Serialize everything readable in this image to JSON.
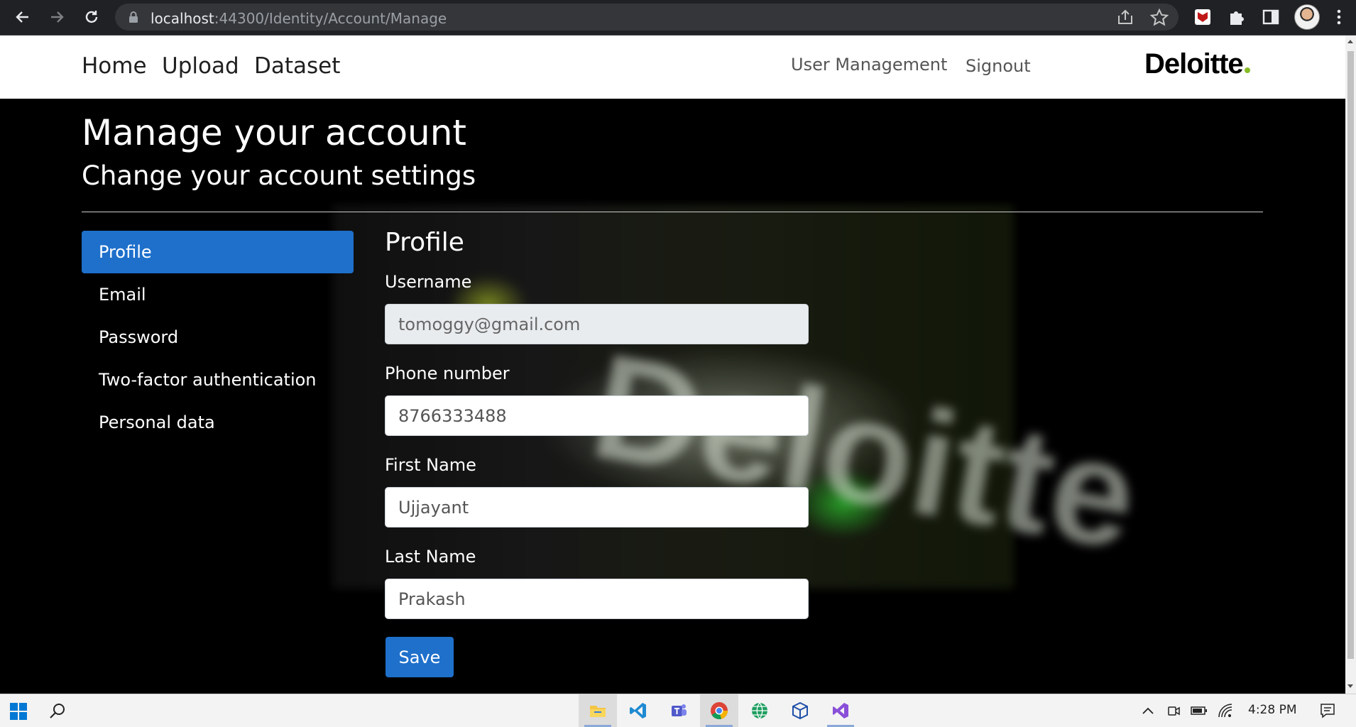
{
  "browser": {
    "url_host": "localhost",
    "url_path": ":44300/Identity/Account/Manage"
  },
  "header": {
    "nav": [
      "Home",
      "Upload",
      "Dataset"
    ],
    "user_management": "User Management",
    "signout": "Signout",
    "logo_text": "Deloitte",
    "logo_dot_color": "#86bc25"
  },
  "page": {
    "title": "Manage your account",
    "subtitle": "Change your account settings"
  },
  "sidebar": {
    "items": [
      {
        "label": "Profile",
        "active": true
      },
      {
        "label": "Email"
      },
      {
        "label": "Password"
      },
      {
        "label": "Two-factor authentication"
      },
      {
        "label": "Personal data"
      }
    ]
  },
  "form": {
    "title": "Profile",
    "username_label": "Username",
    "username_value": "tomoggy@gmail.com",
    "phone_label": "Phone number",
    "phone_value": "8766333488",
    "first_name_label": "First Name",
    "first_name_value": "Ujjayant",
    "last_name_label": "Last Name",
    "last_name_value": "Prakash",
    "save_label": "Save"
  },
  "taskbar": {
    "clock": "4:28 PM",
    "apps": [
      "file-explorer-icon",
      "vscode-icon",
      "teams-icon",
      "chrome-icon",
      "web-browser-icon",
      "virtualbox-icon",
      "visual-studio-icon"
    ]
  },
  "colors": {
    "accent": "#1e70cb",
    "header_bg": "#ffffff",
    "page_bg": "#000000"
  }
}
